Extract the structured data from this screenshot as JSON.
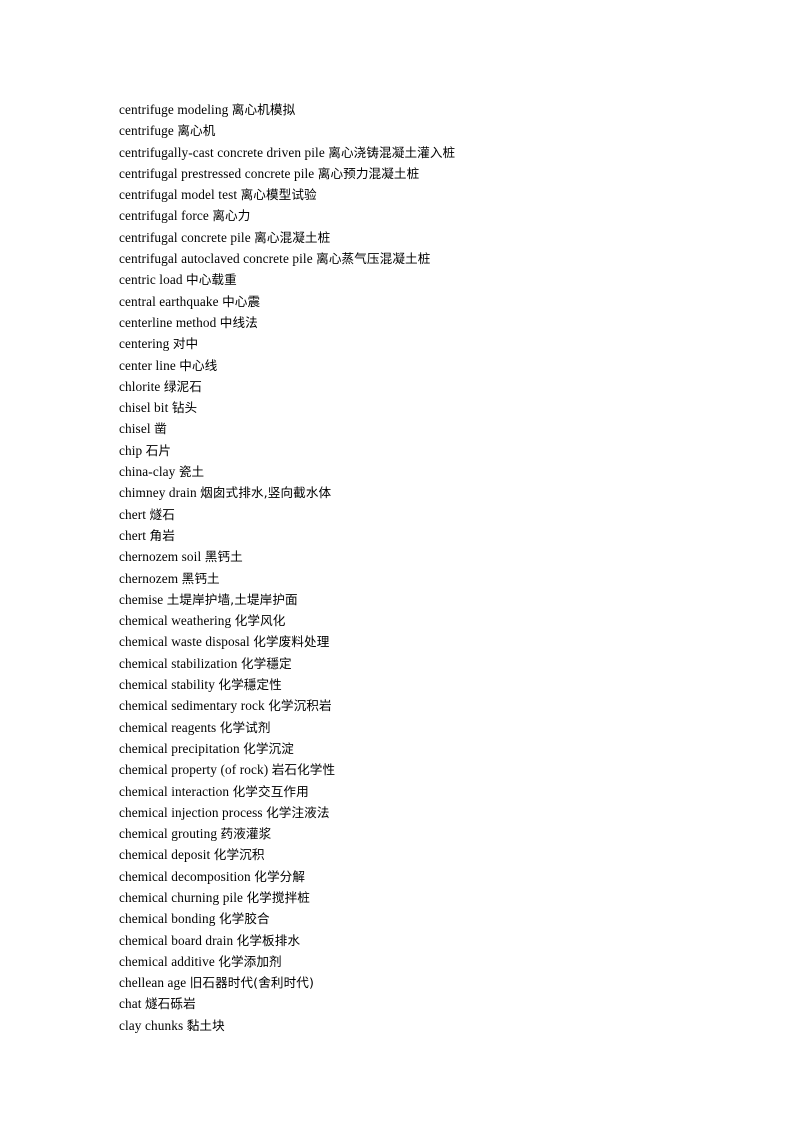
{
  "document": {
    "type": "bilingual-glossary-page",
    "language_pair": "English-Chinese",
    "page_background": "#ffffff",
    "text_color": "#000000",
    "entry_count": 43,
    "entries": [
      {
        "term": "centrifuge modeling",
        "gloss": "离心机模拟"
      },
      {
        "term": "centrifuge",
        "gloss": "离心机"
      },
      {
        "term": "centrifugally-cast concrete driven pile",
        "gloss": "离心浇铸混凝土灌入桩"
      },
      {
        "term": "centrifugal prestressed concrete pile",
        "gloss": "离心预力混凝土桩"
      },
      {
        "term": "centrifugal model test",
        "gloss": "离心模型试验"
      },
      {
        "term": "centrifugal force",
        "gloss": "离心力"
      },
      {
        "term": "centrifugal concrete pile",
        "gloss": "离心混凝土桩"
      },
      {
        "term": "centrifugal autoclaved concrete pile",
        "gloss": "离心蒸气压混凝土桩"
      },
      {
        "term": "centric load",
        "gloss": "中心载重"
      },
      {
        "term": "central earthquake",
        "gloss": "中心震"
      },
      {
        "term": "centerline method",
        "gloss": "中线法"
      },
      {
        "term": "centering",
        "gloss": "对中"
      },
      {
        "term": "center line",
        "gloss": "中心线"
      },
      {
        "term": "chlorite",
        "gloss": "绿泥石"
      },
      {
        "term": "chisel bit",
        "gloss": "钻头"
      },
      {
        "term": "chisel",
        "gloss": "凿"
      },
      {
        "term": "chip",
        "gloss": "石片"
      },
      {
        "term": "china-clay",
        "gloss": "瓷土"
      },
      {
        "term": "chimney drain",
        "gloss": "烟囱式排水,竖向截水体"
      },
      {
        "term": "chert",
        "gloss": "燧石"
      },
      {
        "term": "chert",
        "gloss": "角岩"
      },
      {
        "term": "chernozem soil",
        "gloss": "黑钙土"
      },
      {
        "term": "chernozem",
        "gloss": "黑钙土"
      },
      {
        "term": "chemise",
        "gloss": "土堤岸护墙,土堤岸护面"
      },
      {
        "term": "chemical weathering",
        "gloss": "化学风化"
      },
      {
        "term": "chemical waste disposal",
        "gloss": "化学废料处理"
      },
      {
        "term": "chemical stabilization",
        "gloss": "化学穩定"
      },
      {
        "term": "chemical stability",
        "gloss": "化学穩定性"
      },
      {
        "term": "chemical sedimentary rock",
        "gloss": "化学沉积岩"
      },
      {
        "term": "chemical reagents",
        "gloss": "化学试剂"
      },
      {
        "term": "chemical precipitation",
        "gloss": "化学沉淀"
      },
      {
        "term": "chemical property (of rock)",
        "gloss": "岩石化学性"
      },
      {
        "term": "chemical interaction",
        "gloss": "化学交互作用"
      },
      {
        "term": "chemical injection process",
        "gloss": "化学注液法"
      },
      {
        "term": "chemical grouting",
        "gloss": "药液灌浆"
      },
      {
        "term": "chemical deposit",
        "gloss": "化学沉积"
      },
      {
        "term": "chemical decomposition",
        "gloss": "化学分解"
      },
      {
        "term": "chemical churning pile",
        "gloss": "化学搅拌桩"
      },
      {
        "term": "chemical bonding",
        "gloss": "化学胶合"
      },
      {
        "term": "chemical board drain",
        "gloss": "化学板排水"
      },
      {
        "term": "chemical additive",
        "gloss": "化学添加剂"
      },
      {
        "term": "chellean age",
        "gloss": "旧石器时代(舍利时代)"
      },
      {
        "term": "chat",
        "gloss": "燧石砾岩"
      },
      {
        "term": "clay chunks",
        "gloss": "黏土块"
      }
    ]
  }
}
